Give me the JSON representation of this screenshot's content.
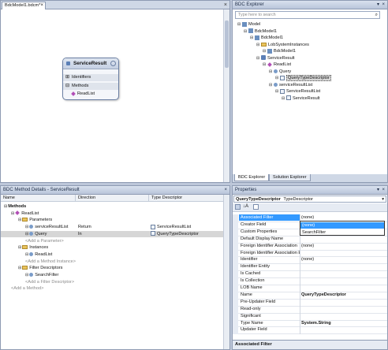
{
  "designer": {
    "tab_title": "BdcModel1.bdcm*",
    "entity": {
      "name": "ServiceResult",
      "identifiers_label": "Identifiers",
      "methods_label": "Methods",
      "method_item": "ReadList"
    }
  },
  "bdc_explorer": {
    "title": "BDC Explorer",
    "search_placeholder": "Type here to search",
    "tree": [
      {
        "label": "Model",
        "level": 0,
        "icon": "model-icon"
      },
      {
        "label": "BdcModel1",
        "level": 1,
        "icon": "model-icon"
      },
      {
        "label": "BdcModel1",
        "level": 2,
        "icon": "model-icon"
      },
      {
        "label": "LobSystemInstances",
        "level": 3,
        "icon": "folder-icon"
      },
      {
        "label": "BdcModel1",
        "level": 4,
        "icon": "model-icon"
      },
      {
        "label": "ServiceResult",
        "level": 3,
        "icon": "entity-icon"
      },
      {
        "label": "ReadList",
        "level": 4,
        "icon": "method-icon"
      },
      {
        "label": "Query",
        "level": 5,
        "icon": "param-icon"
      },
      {
        "label": "QueryTypeDescriptor",
        "level": 6,
        "icon": "typedescriptor-icon",
        "selected": true
      },
      {
        "label": "serviceResultList",
        "level": 5,
        "icon": "param-icon"
      },
      {
        "label": "ServiceResultList",
        "level": 6,
        "icon": "typedescriptor-icon"
      },
      {
        "label": "ServiceResult",
        "level": 7,
        "icon": "typedescriptor-icon"
      }
    ],
    "tabs": [
      "BDC Explorer",
      "Solution Explorer"
    ]
  },
  "method_details": {
    "title": "BDC Method Details - ServiceResult",
    "columns": [
      "Name",
      "Direction",
      "Type Descriptor"
    ],
    "rows": [
      {
        "name": "Methods",
        "level": 0,
        "bold": true
      },
      {
        "name": "ReadList",
        "level": 1,
        "icon": "method-icon"
      },
      {
        "name": "Parameters",
        "level": 2,
        "icon": "folder-icon"
      },
      {
        "name": "serviceResultList",
        "level": 3,
        "icon": "param-icon",
        "direction": "Return",
        "td": "ServiceResultList"
      },
      {
        "name": "Query",
        "level": 3,
        "icon": "param-icon",
        "direction": "In",
        "td": "QueryTypeDescriptor",
        "highlight": true
      },
      {
        "name": "<Add a Parameter>",
        "level": 3,
        "gray": true
      },
      {
        "name": "Instances",
        "level": 2,
        "icon": "folder-icon"
      },
      {
        "name": "ReadList",
        "level": 3,
        "icon": "param-icon"
      },
      {
        "name": "<Add a Method Instance>",
        "level": 3,
        "gray": true
      },
      {
        "name": "Filter Descriptors",
        "level": 2,
        "icon": "folder-icon"
      },
      {
        "name": "SearchFilter",
        "level": 3,
        "icon": "param-icon"
      },
      {
        "name": "<Add a Filter Descriptor>",
        "level": 3,
        "gray": true
      },
      {
        "name": "<Add a Method>",
        "level": 1,
        "gray": true
      }
    ]
  },
  "properties": {
    "title": "Properties",
    "object_name": "QueryTypeDescriptor",
    "object_type": "TypeDescriptor",
    "rows": [
      {
        "name": "Associated Filter",
        "value": "(none)",
        "selected": true
      },
      {
        "name": "Creator Field",
        "value": ""
      },
      {
        "name": "Custom Properties",
        "value": ""
      },
      {
        "name": "Default Display Name",
        "value": ""
      },
      {
        "name": "Foreign Identifier Association",
        "value": "(none)"
      },
      {
        "name": "Foreign Identifier Association E",
        "value": ""
      },
      {
        "name": "Identifier",
        "value": "(none)"
      },
      {
        "name": "Identifier Entity",
        "value": ""
      },
      {
        "name": "Is Cached",
        "value": ""
      },
      {
        "name": "Is Collection",
        "value": ""
      },
      {
        "name": "LOB Name",
        "value": ""
      },
      {
        "name": "Name",
        "value": "QueryTypeDescriptor",
        "bold": true
      },
      {
        "name": "Pre-Updater Field",
        "value": ""
      },
      {
        "name": "Read-only",
        "value": ""
      },
      {
        "name": "Significant",
        "value": ""
      },
      {
        "name": "Type Name",
        "value": "System.String",
        "bold": true
      },
      {
        "name": "Updater Field",
        "value": ""
      }
    ],
    "dropdown_options": [
      "(none)",
      "SearchFilter"
    ],
    "description_title": "Associated Filter"
  }
}
